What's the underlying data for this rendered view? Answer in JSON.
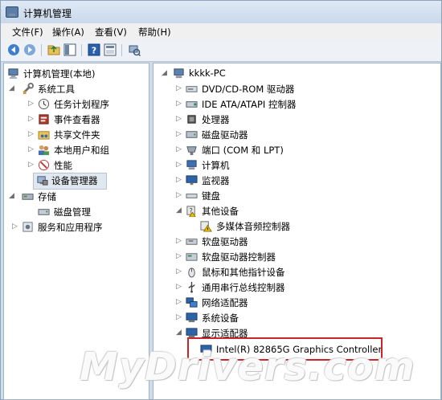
{
  "window": {
    "title": "计算机管理"
  },
  "menu": [
    "文件(F)",
    "操作(A)",
    "查看(V)",
    "帮助(H)"
  ],
  "toolbar": {
    "icons": [
      "back-arrow-icon",
      "forward-arrow-icon",
      "up-folder-icon",
      "show-hide-tree-icon",
      "help-icon",
      "properties-icon",
      "scan-hardware-icon"
    ]
  },
  "left_tree": {
    "root": "计算机管理(本地)",
    "system_tools": "系统工具",
    "task_scheduler": "任务计划程序",
    "event_viewer": "事件查看器",
    "shared_folders": "共享文件夹",
    "local_users": "本地用户和组",
    "performance": "性能",
    "device_manager": "设备管理器",
    "storage": "存储",
    "disk_management": "磁盘管理",
    "services": "服务和应用程序"
  },
  "right_tree": {
    "computer": "kkkk-PC",
    "dvd": "DVD/CD-ROM 驱动器",
    "ide": "IDE ATA/ATAPI 控制器",
    "cpu": "处理器",
    "disk": "磁盘驱动器",
    "ports": "端口 (COM 和 LPT)",
    "computer_node": "计算机",
    "monitor": "监视器",
    "keyboard": "键盘",
    "other_devices": "其他设备",
    "multimedia": "多媒体音频控制器",
    "floppy": "软盘驱动器",
    "floppy_ctrl": "软盘驱动器控制器",
    "mouse": "鼠标和其他指针设备",
    "usb": "通用串行总线控制器",
    "network": "网络适配器",
    "system_devices": "系统设备",
    "display": "显示适配器",
    "gpu": "Intel(R) 82865G Graphics Controller"
  },
  "watermark": "MyDrivers.com",
  "colors": {
    "highlight_box": "#c8262a",
    "selection": "#e1e7ef"
  }
}
